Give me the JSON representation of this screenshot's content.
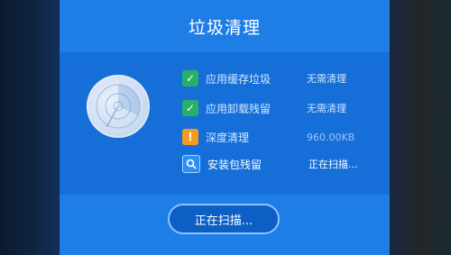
{
  "dialog": {
    "title": "垃圾清理",
    "items": [
      {
        "icon": "check-icon",
        "label": "应用缓存垃圾",
        "value": "无需清理"
      },
      {
        "icon": "check-icon",
        "label": "应用卸载残留",
        "value": "无需清理"
      },
      {
        "icon": "warning-icon",
        "label": "深度清理",
        "value": "960.00KB"
      },
      {
        "icon": "search-icon",
        "label": "安装包残留",
        "value": "正在扫描..."
      }
    ],
    "button": {
      "label": "正在扫描..."
    },
    "colors": {
      "dialog_bg": "#1f7de6",
      "panel_bg": "#166fd8",
      "check": "#27b06a",
      "warning": "#f39c23"
    }
  }
}
